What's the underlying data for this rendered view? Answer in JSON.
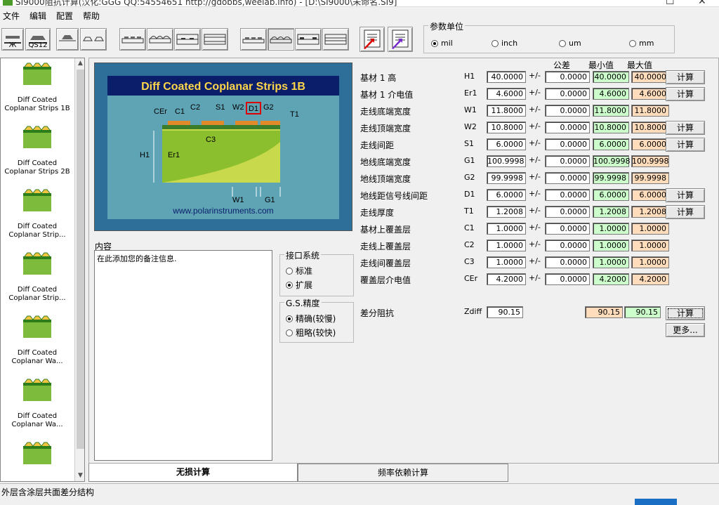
{
  "window": {
    "title": "SI9000阻抗计算(汉化:GGG QQ:54554651 http://gdobbs,weelab.info) - [D:\\SI9000\\未命名.SI9]"
  },
  "menu": [
    "文件",
    "编辑",
    "配置",
    "帮助"
  ],
  "toolbar": {
    "btn1_sub": "Ж",
    "btn2_sub": "QS12"
  },
  "units": {
    "group_label": "参数单位",
    "options": [
      {
        "label": "mil",
        "selected": true
      },
      {
        "label": "inch",
        "selected": false
      },
      {
        "label": "um",
        "selected": false
      },
      {
        "label": "mm",
        "selected": false
      }
    ]
  },
  "models": [
    "Diff Coated Coplanar Strips 1B",
    "Diff Coated Coplanar Strips 2B",
    "Diff Coated Coplanar Strip...",
    "Diff Coated Coplanar Strip...",
    "Diff Coated Coplanar Wa...",
    "Diff Coated Coplanar Wa..."
  ],
  "diagram": {
    "title": "Diff Coated Coplanar Strips 1B",
    "url": "www.polarinstruments.com",
    "labels": {
      "cer": "CEr",
      "c1": "C1",
      "c2": "C2",
      "s1": "S1",
      "w2": "W2",
      "d1": "D1",
      "g2": "G2",
      "t1": "T1",
      "c3": "C3",
      "h1": "H1",
      "er1": "Er1",
      "w1": "W1",
      "g1": "G1"
    }
  },
  "notes": {
    "label": "内容",
    "text": "在此添加您的备注信息."
  },
  "interface": {
    "label": "接口系统",
    "options": [
      {
        "label": "标准",
        "selected": false
      },
      {
        "label": "扩展",
        "selected": true
      }
    ]
  },
  "precision": {
    "label": "G.S.精度",
    "options": [
      {
        "label": "精确(较慢)",
        "selected": true
      },
      {
        "label": "粗略(较快)",
        "selected": false
      }
    ]
  },
  "columns": {
    "tolerance": "公差",
    "min": "最小值",
    "max": "最大值"
  },
  "params": [
    {
      "label": "基材 1 高",
      "sym": "H1",
      "value": "40.0000",
      "pm": "+/-",
      "tol": "0.0000",
      "min": "40.0000",
      "max": "40.0000",
      "calc": "计算"
    },
    {
      "label": "基材 1 介电值",
      "sym": "Er1",
      "value": "4.6000",
      "pm": "+/-",
      "tol": "0.0000",
      "min": "4.6000",
      "max": "4.6000",
      "calc": "计算"
    },
    {
      "label": "走线底端宽度",
      "sym": "W1",
      "value": "11.8000",
      "pm": "+/-",
      "tol": "0.0000",
      "min": "11.8000",
      "max": "11.8000",
      "calc": ""
    },
    {
      "label": "走线顶端宽度",
      "sym": "W2",
      "value": "10.8000",
      "pm": "+/-",
      "tol": "0.0000",
      "min": "10.8000",
      "max": "10.8000",
      "calc": "计算"
    },
    {
      "label": "走线间距",
      "sym": "S1",
      "value": "6.0000",
      "pm": "+/-",
      "tol": "0.0000",
      "min": "6.0000",
      "max": "6.0000",
      "calc": "计算"
    },
    {
      "label": "地线底端宽度",
      "sym": "G1",
      "value": "100.9998",
      "pm": "+/-",
      "tol": "0.0000",
      "min": "100.9998",
      "max": "100.9998",
      "calc": ""
    },
    {
      "label": "地线顶端宽度",
      "sym": "G2",
      "value": "99.9998",
      "pm": "+/-",
      "tol": "0.0000",
      "min": "99.9998",
      "max": "99.9998",
      "calc": ""
    },
    {
      "label": "地线距信号线间距",
      "sym": "D1",
      "value": "6.0000",
      "pm": "+/-",
      "tol": "0.0000",
      "min": "6.0000",
      "max": "6.0000",
      "calc": "计算"
    },
    {
      "label": "走线厚度",
      "sym": "T1",
      "value": "1.2008",
      "pm": "+/-",
      "tol": "0.0000",
      "min": "1.2008",
      "max": "1.2008",
      "calc": "计算"
    },
    {
      "label": "基材上覆盖层",
      "sym": "C1",
      "value": "1.0000",
      "pm": "+/-",
      "tol": "0.0000",
      "min": "1.0000",
      "max": "1.0000",
      "calc": ""
    },
    {
      "label": "走线上覆盖层",
      "sym": "C2",
      "value": "1.0000",
      "pm": "+/-",
      "tol": "0.0000",
      "min": "1.0000",
      "max": "1.0000",
      "calc": ""
    },
    {
      "label": "走线间覆盖层",
      "sym": "C3",
      "value": "1.0000",
      "pm": "+/-",
      "tol": "0.0000",
      "min": "1.0000",
      "max": "1.0000",
      "calc": ""
    },
    {
      "label": "覆盖层介电值",
      "sym": "CEr",
      "value": "4.2000",
      "pm": "+/-",
      "tol": "0.0000",
      "min": "4.2000",
      "max": "4.2000",
      "calc": ""
    }
  ],
  "impedance": {
    "label": "差分阻抗",
    "sym": "Zdiff",
    "value": "90.15",
    "min": "90.15",
    "max": "90.15",
    "calc": "计算",
    "more": "更多..."
  },
  "tabs": [
    {
      "label": "无损计算",
      "active": true
    },
    {
      "label": "频率依赖计算",
      "active": false
    }
  ],
  "status": "外层含涂层共面差分结构"
}
